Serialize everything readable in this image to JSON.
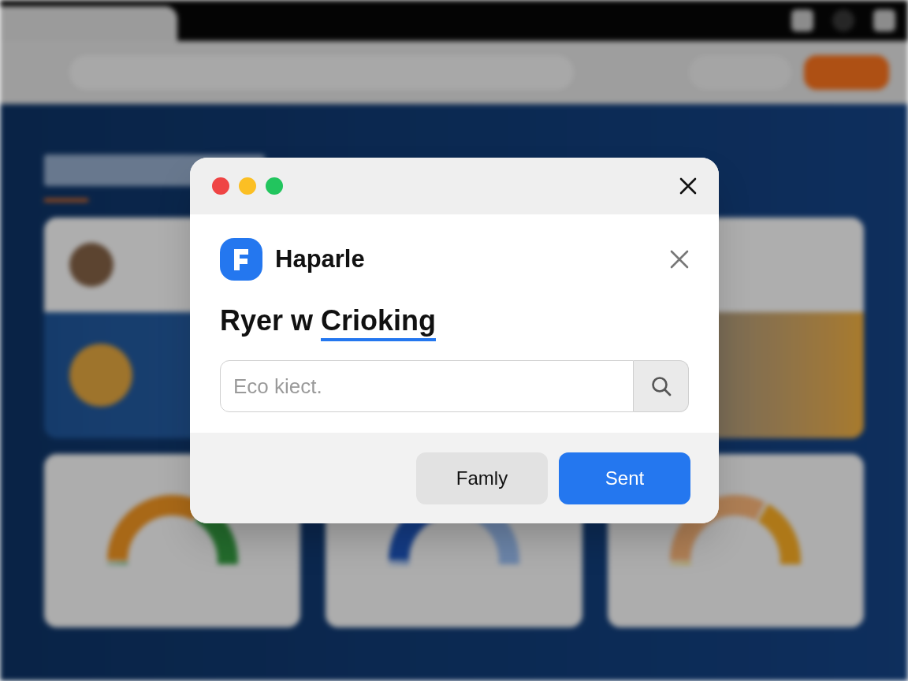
{
  "dialog": {
    "window_controls": [
      {
        "color": "#ef4444"
      },
      {
        "color": "#fbbf24"
      },
      {
        "color": "#22c55e"
      }
    ],
    "app_name": "Haparle",
    "heading": "Ryer w",
    "heading_highlight": "Crioking",
    "search": {
      "placeholder": "Eco kiect."
    },
    "buttons": [
      {
        "label": "Famly",
        "kind": "secondary"
      },
      {
        "label": "Sent",
        "kind": "primary"
      }
    ]
  }
}
